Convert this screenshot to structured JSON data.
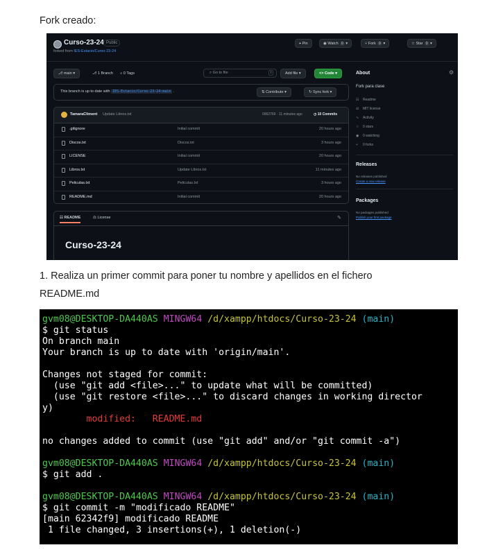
{
  "doc": {
    "caption": "Fork creado:",
    "step1_line1": "1. Realiza un primer commit para poner tu nombre y apellidos en el fichero",
    "step1_line2": "README.md"
  },
  "github": {
    "repo_name": "Curso-23-24",
    "visibility": "Public",
    "forked_from_prefix": "forked from",
    "forked_from_repo": "IES-Estacio/Curso-23-24",
    "header_buttons": {
      "pin": "Pin",
      "watch": "Watch",
      "watch_count": "0",
      "fork": "Fork",
      "fork_count": "0",
      "star": "Star",
      "star_count": "0"
    },
    "toolbar": {
      "branch": "main",
      "branches": "1 Branch",
      "tags": "0 Tags",
      "search_placeholder": "Go to file",
      "search_key": "t",
      "add_file": "Add file",
      "code": "Code"
    },
    "status": {
      "message": "This branch is up to date with",
      "ref": "IES-Estacio/Curso-23-24:main",
      "contribute": "Contribute",
      "sync_fork": "Sync fork"
    },
    "latest_commit": {
      "user": "TamaraCliment",
      "message": "Update Libros.txt",
      "meta": "0962769 · 11 minutes ago",
      "commits": "10 Commits"
    },
    "files": [
      {
        "name": ".gitignore",
        "commit": "Initial commit",
        "date": "20 hours ago"
      },
      {
        "name": "Discos.txt",
        "commit": "Discos.txt",
        "date": "3 hours ago"
      },
      {
        "name": "LICENSE",
        "commit": "Initial commit",
        "date": "20 hours ago"
      },
      {
        "name": "Libros.txt",
        "commit": "Update Libros.txt",
        "date": "11 minutes ago"
      },
      {
        "name": "Peliculas.txt",
        "commit": "Peliculas.txt",
        "date": "3 hours ago"
      },
      {
        "name": "README.md",
        "commit": "Initial commit",
        "date": "20 hours ago"
      }
    ],
    "readme": {
      "tab_readme": "README",
      "tab_license": "License",
      "heading": "Curso-23-24"
    },
    "about": {
      "title": "About",
      "description": "Fork para clase",
      "items": [
        "Readme",
        "MIT license",
        "Activity",
        "0 stars",
        "0 watching",
        "0 forks"
      ],
      "releases_title": "Releases",
      "releases_none": "No releases published",
      "releases_link": "Create a new release",
      "packages_title": "Packages",
      "packages_none": "No packages published",
      "packages_link": "Publish your first package"
    }
  },
  "terminal": {
    "prompt_user": "gvm08@DESKTOP-DA440AS",
    "prompt_env": "MINGW64",
    "prompt_path": "/d/xampp/htdocs/Curso-23-24",
    "prompt_branch": "(main)",
    "cmd1": "$ git status",
    "out1": "On branch main",
    "out2": "Your branch is up to date with 'origin/main'.",
    "out3": "Changes not staged for commit:",
    "out4": "  (use \"git add <file>...\" to update what will be committed)",
    "out5": "  (use \"git restore <file>...\" to discard changes in working director",
    "out6": "y)",
    "modified_label": "        modified:   README.md",
    "out7": "no changes added to commit (use \"git add\" and/or \"git commit -a\")",
    "cmd2": "$ git add .",
    "cmd3": "$ git commit -m \"modificado README\"",
    "out8": "[main 62342f9] modificado README",
    "out9": " 1 file changed, 3 insertions(+), 1 deletion(-)"
  },
  "colors": {
    "terminal_green": "#4ec94e",
    "terminal_magenta": "#c04bc0",
    "terminal_yellow": "#c6c43b",
    "terminal_cyan": "#2ab3c6",
    "terminal_red": "#e23b3b",
    "github_bg": "#0d1117",
    "github_green_button": "#238636"
  }
}
